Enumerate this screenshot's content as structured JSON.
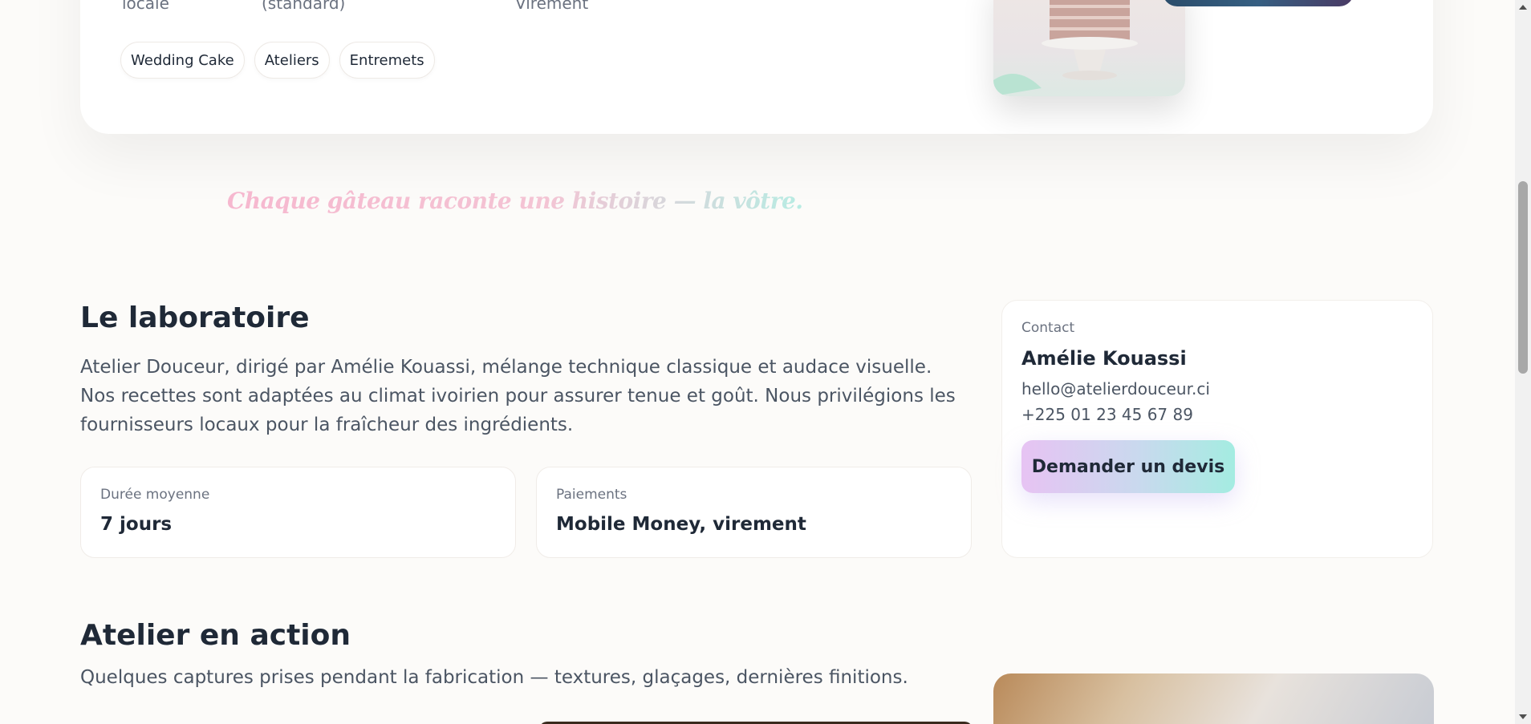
{
  "hero": {
    "meta": [
      "locale",
      "(standard)",
      "Virement"
    ],
    "tags": [
      "Wedding Cake",
      "Ateliers",
      "Entremets"
    ]
  },
  "tagline": "Chaque gâteau raconte une histoire — la vôtre.",
  "lab": {
    "title": "Le laboratoire",
    "text": "Atelier Douceur, dirigé par Amélie Kouassi, mélange technique classique et audace visuelle. Nos recettes sont adaptées au climat ivoirien pour assurer tenue et goût. Nous privilégions les fournisseurs locaux pour la fraîcheur des ingrédients.",
    "stats": [
      {
        "label": "Durée moyenne",
        "value": "7 jours"
      },
      {
        "label": "Paiements",
        "value": "Mobile Money, virement"
      }
    ]
  },
  "contact": {
    "label": "Contact",
    "name": "Amélie Kouassi",
    "email": "hello@atelierdouceur.ci",
    "phone": "+225 01 23 45 67 89",
    "cta": "Demander un devis"
  },
  "action": {
    "title": "Atelier en action",
    "text": "Quelques captures prises pendant la fabrication — textures, glaçages, dernières finitions."
  },
  "colors": {
    "background": "#fcfbf9",
    "text": "#1f2937",
    "muted": "#6b7280",
    "gradient_start": "#e7c3f3",
    "gradient_end": "#a4ece1"
  }
}
